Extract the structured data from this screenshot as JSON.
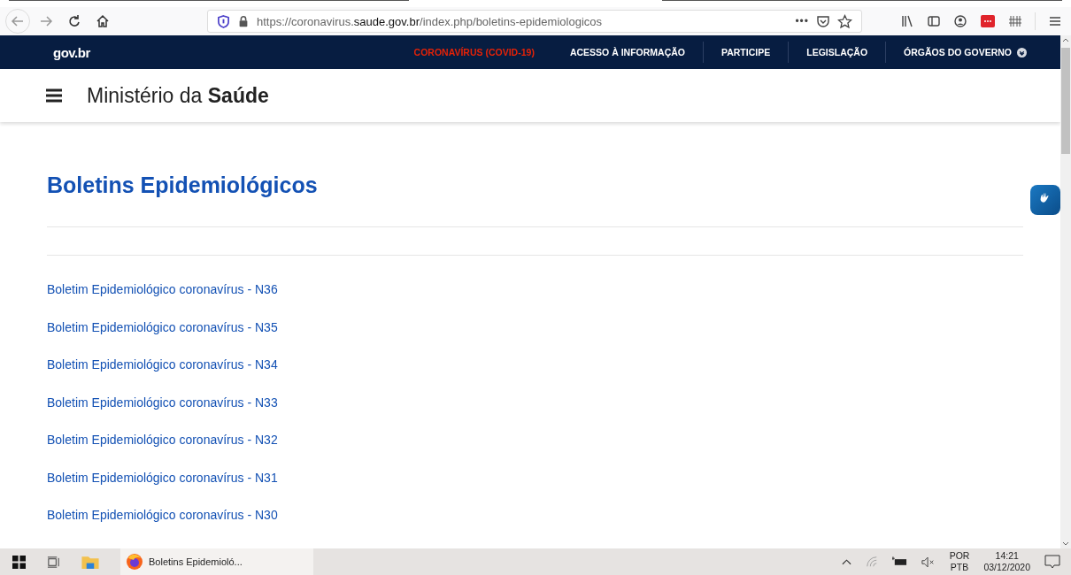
{
  "browser": {
    "url_host_pre": "https://coronavirus.",
    "url_host": "saude.gov.br",
    "url_path": "/index.php/boletins-epidemiologicos",
    "page_actions": "•••"
  },
  "govbar": {
    "logo": "gov.br",
    "links": [
      {
        "label": "CORONAVÍRUS (COVID-19)",
        "kind": "highlight"
      },
      {
        "label": "ACESSO À INFORMAÇÃO",
        "kind": "plain"
      },
      {
        "label": "PARTICIPE",
        "kind": "plain"
      },
      {
        "label": "LEGISLAÇÃO",
        "kind": "plain"
      },
      {
        "label": "ÓRGÃOS DO GOVERNO",
        "kind": "dropdown"
      }
    ]
  },
  "header": {
    "prefix": "Ministério da",
    "brand": "Saúde"
  },
  "page": {
    "title": "Boletins Epidemiológicos",
    "links": [
      "Boletim Epidemiológico coronavírus - N36",
      "Boletim Epidemiológico coronavírus - N35",
      "Boletim Epidemiológico coronavírus - N34",
      "Boletim Epidemiológico coronavírus - N33",
      "Boletim Epidemiológico coronavírus - N32",
      "Boletim Epidemiológico coronavírus - N31",
      "Boletim Epidemiológico coronavírus - N30"
    ]
  },
  "taskbar": {
    "app": "Boletins Epidemioló...",
    "lang1": "POR",
    "lang2": "PTB",
    "time": "14:21",
    "date": "03/12/2020"
  }
}
